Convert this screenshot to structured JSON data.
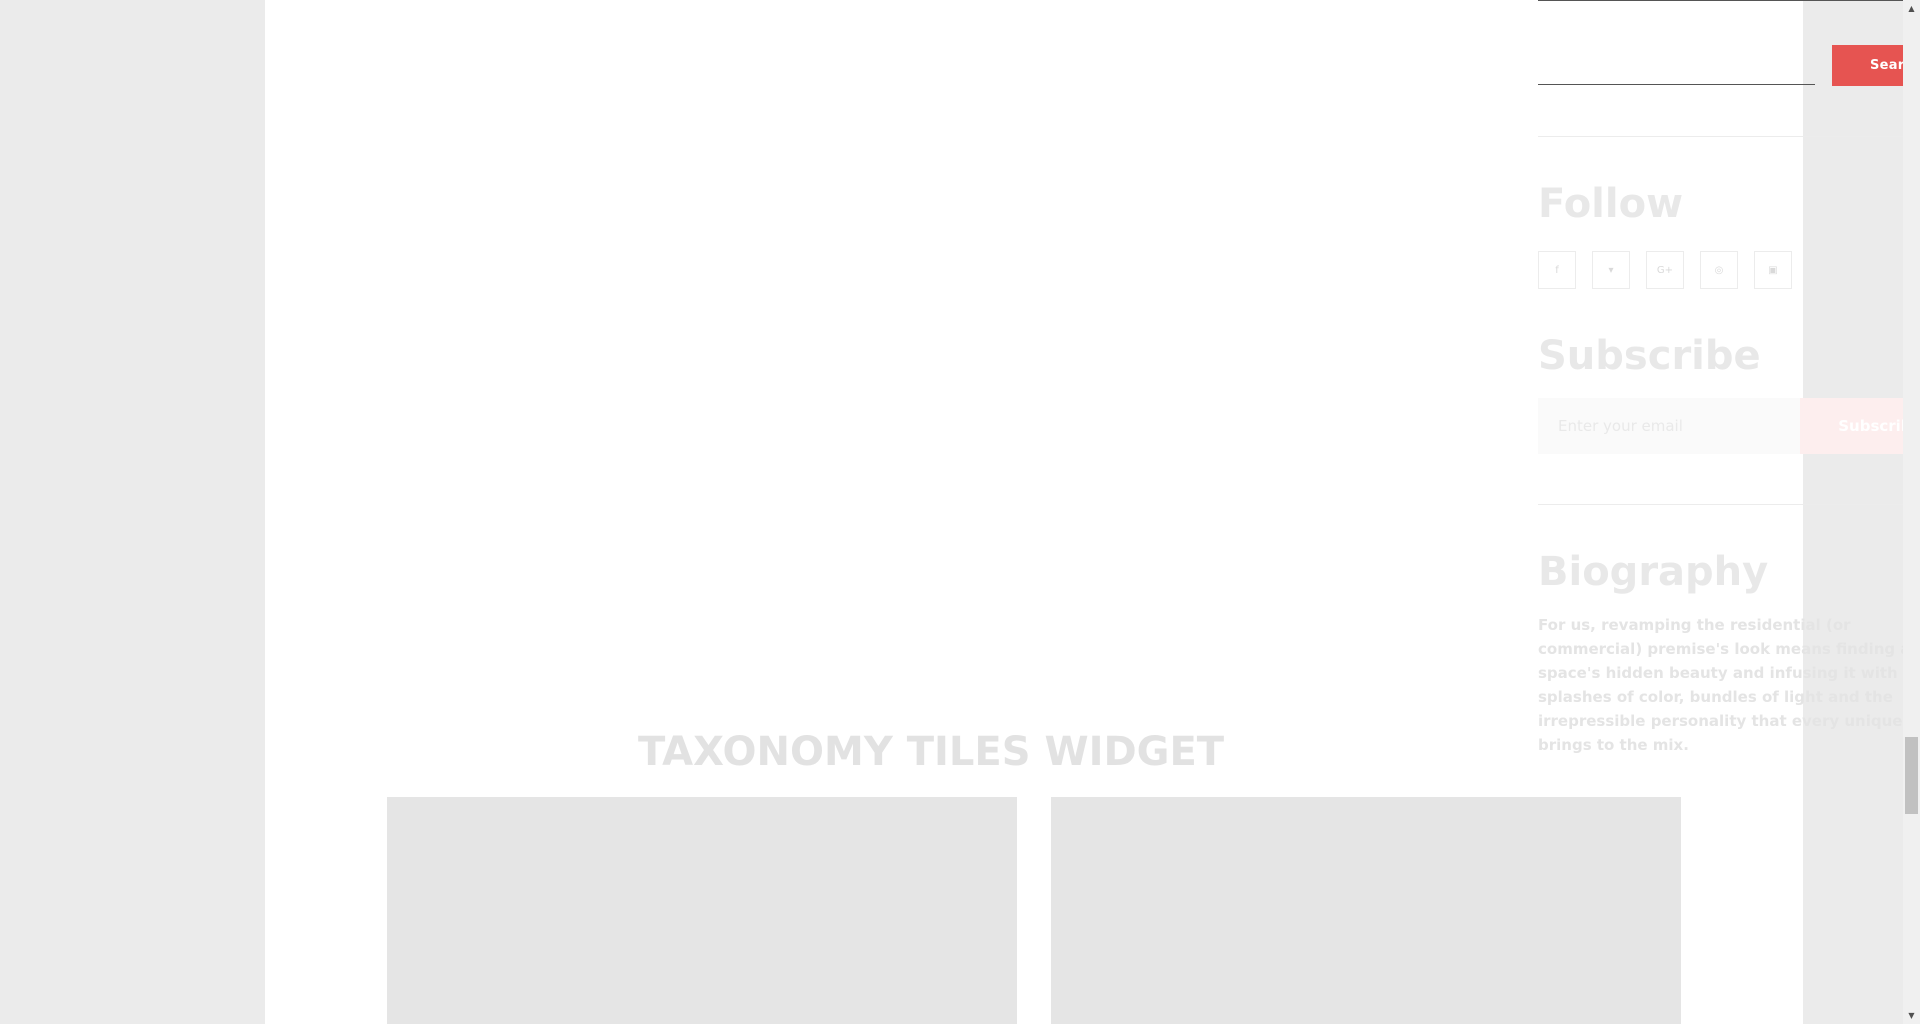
{
  "search": {
    "input_value": "",
    "button_label": "Search"
  },
  "follow": {
    "title": "Follow",
    "icons": [
      "facebook-icon",
      "twitter-icon",
      "google-plus-icon",
      "instagram-icon",
      "youtube-icon"
    ],
    "glyphs": [
      "f",
      "▾",
      "G+",
      "◎",
      "▣"
    ]
  },
  "subscribe": {
    "title": "Subscribe",
    "email_placeholder": "Enter your email",
    "button_label": "Subscribe"
  },
  "biography": {
    "title": "Biography",
    "text": "For us, revamping the residential (or commercial) premise's look means finding a space's hidden beauty and infusing it with splashes of color, bundles of light and the irrepressible personality that every unique client brings to the mix."
  },
  "taxonomy": {
    "title": "TAXONOMY TILES WIDGET"
  },
  "colors": {
    "accent": "#e65451",
    "accent_faded": "#fdeeee",
    "tile": "#e5e5e5",
    "backdrop": "#ebebeb"
  },
  "scrollbar": {
    "up_glyph": "▲",
    "down_glyph": "▼"
  }
}
